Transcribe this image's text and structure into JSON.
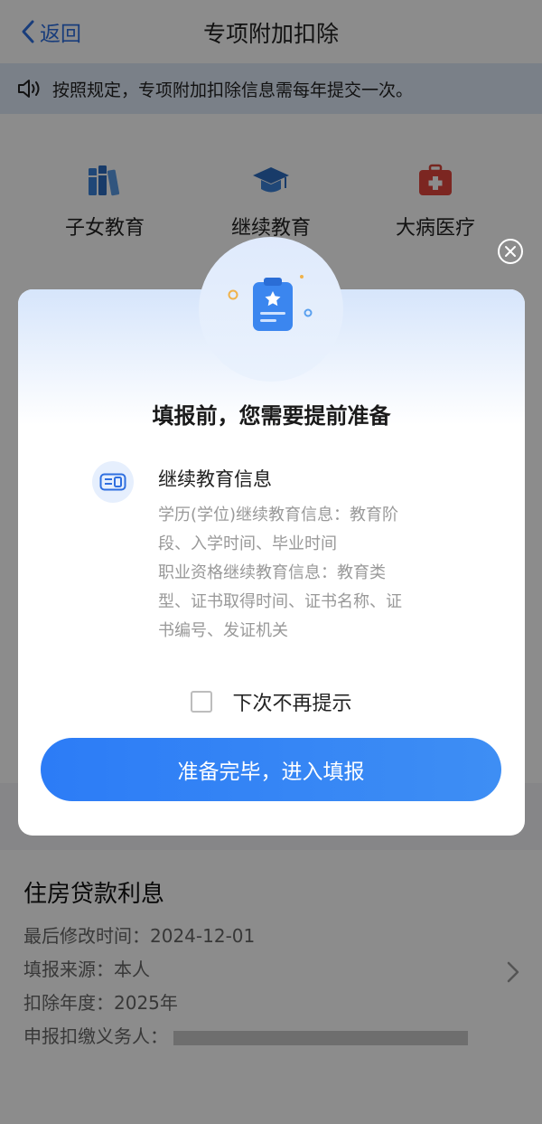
{
  "nav": {
    "back_label": "返回",
    "title": "专项附加扣除"
  },
  "notice": {
    "text": "按照规定，专项附加扣除信息需每年提交一次。"
  },
  "categories": [
    {
      "label": "子女教育",
      "icon": "books-icon"
    },
    {
      "label": "继续教育",
      "icon": "graduation-cap-icon"
    },
    {
      "label": "大病医疗",
      "icon": "medical-kit-icon"
    }
  ],
  "modal": {
    "title": "填报前，您需要提前准备",
    "section_title": "继续教育信息",
    "lines": [
      "学历(学位)继续教育信息：教育阶",
      "段、入学时间、毕业时间",
      "职业资格继续教育信息：教育类",
      "型、证书取得时间、证书名称、证",
      "书编号、发证机关"
    ],
    "dont_remind": "下次不再提示",
    "primary_button": "准备完毕，进入填报"
  },
  "record": {
    "title": "住房贷款利息",
    "last_modified": "最后修改时间：2024-12-01",
    "source": "填报来源：本人",
    "year": "扣除年度：2025年",
    "withholding_agent_label": "申报扣缴义务人："
  },
  "colors": {
    "accent": "#2f6fe0",
    "button": "#2c7cf6",
    "notice_bg": "#dfe9f8"
  }
}
